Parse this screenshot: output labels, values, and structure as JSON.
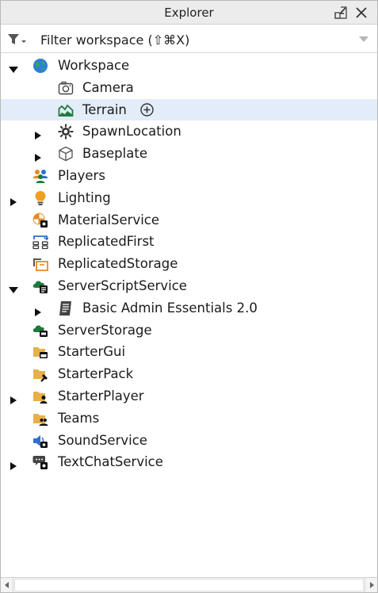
{
  "window": {
    "title": "Explorer"
  },
  "filter": {
    "placeholder": "Filter workspace (⇧⌘X)"
  },
  "tree": [
    {
      "label": "Workspace",
      "depth": 0,
      "arrow": "down",
      "icon": "globe-icon",
      "name": "tree-item-workspace"
    },
    {
      "label": "Camera",
      "depth": 1,
      "arrow": "none",
      "icon": "camera-icon",
      "name": "tree-item-camera"
    },
    {
      "label": "Terrain",
      "depth": 1,
      "arrow": "none",
      "icon": "terrain-icon",
      "name": "tree-item-terrain",
      "selected": true,
      "add": true
    },
    {
      "label": "SpawnLocation",
      "depth": 1,
      "arrow": "right",
      "icon": "spawn-gear-icon",
      "name": "tree-item-spawnlocation"
    },
    {
      "label": "Baseplate",
      "depth": 1,
      "arrow": "right",
      "icon": "cube-icon",
      "name": "tree-item-baseplate"
    },
    {
      "label": "Players",
      "depth": 0,
      "arrow": "none",
      "icon": "players-icon",
      "name": "tree-item-players"
    },
    {
      "label": "Lighting",
      "depth": 0,
      "arrow": "right",
      "icon": "lightbulb-icon",
      "name": "tree-item-lighting"
    },
    {
      "label": "MaterialService",
      "depth": 0,
      "arrow": "none",
      "icon": "material-service-icon",
      "name": "tree-item-materialservice"
    },
    {
      "label": "ReplicatedFirst",
      "depth": 0,
      "arrow": "none",
      "icon": "replicated-first-icon",
      "name": "tree-item-replicatedfirst"
    },
    {
      "label": "ReplicatedStorage",
      "depth": 0,
      "arrow": "none",
      "icon": "replicated-storage-icon",
      "name": "tree-item-replicatedstorage"
    },
    {
      "label": "ServerScriptService",
      "depth": 0,
      "arrow": "down",
      "icon": "server-script-service-icon",
      "name": "tree-item-serverscriptservice"
    },
    {
      "label": "Basic Admin Essentials 2.0",
      "depth": 1,
      "arrow": "right",
      "icon": "script-icon",
      "name": "tree-item-basic-admin-essentials"
    },
    {
      "label": "ServerStorage",
      "depth": 0,
      "arrow": "none",
      "icon": "server-storage-icon",
      "name": "tree-item-serverstorage"
    },
    {
      "label": "StarterGui",
      "depth": 0,
      "arrow": "none",
      "icon": "starter-gui-icon",
      "name": "tree-item-startergui"
    },
    {
      "label": "StarterPack",
      "depth": 0,
      "arrow": "none",
      "icon": "starter-pack-icon",
      "name": "tree-item-starterpack"
    },
    {
      "label": "StarterPlayer",
      "depth": 0,
      "arrow": "right",
      "icon": "starter-player-icon",
      "name": "tree-item-starterplayer"
    },
    {
      "label": "Teams",
      "depth": 0,
      "arrow": "none",
      "icon": "teams-icon",
      "name": "tree-item-teams"
    },
    {
      "label": "SoundService",
      "depth": 0,
      "arrow": "none",
      "icon": "speaker-icon",
      "name": "tree-item-soundservice"
    },
    {
      "label": "TextChatService",
      "depth": 0,
      "arrow": "right",
      "icon": "chat-icon",
      "name": "tree-item-textchatservice"
    }
  ],
  "colors": {
    "selected_row": "#e2edf9",
    "folder_yellow": "#e8b04a",
    "green": "#1e7a3c",
    "blue": "#2f6fd1",
    "orange": "#e58a1f"
  }
}
